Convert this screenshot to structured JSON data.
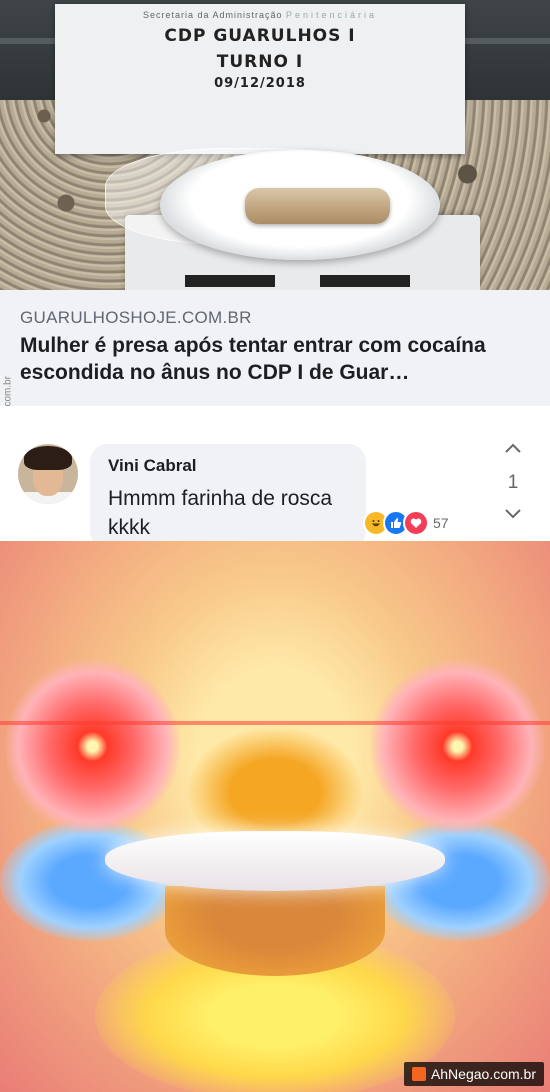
{
  "photo": {
    "sign_header": "Secretaria da Administração",
    "sign_header_brand": "Penitenciária",
    "sign_line1": "CDP GUARULHOS I",
    "sign_line2": "TURNO I",
    "sign_date": "09/12/2018"
  },
  "link_preview": {
    "domain": "GUARULHOSHOJE.COM.BR",
    "headline": "Mulher é presa após tentar entrar com cocaína escondida no ânus no CDP I de Guar…"
  },
  "side_watermark": "AhNegao.com.br",
  "comment": {
    "author": "Vini Cabral",
    "text": "Hmmm farinha de rosca  kkkk",
    "reaction_count": "57",
    "reactions": [
      "haha-icon",
      "like-icon",
      "love-icon"
    ],
    "vote_count": "1"
  },
  "meme": {
    "watermark": "AhNegao.com.br"
  },
  "colors": {
    "facebook_blue": "#1877f2",
    "love_red": "#f33e58",
    "haha_yellow": "#f7b928"
  }
}
